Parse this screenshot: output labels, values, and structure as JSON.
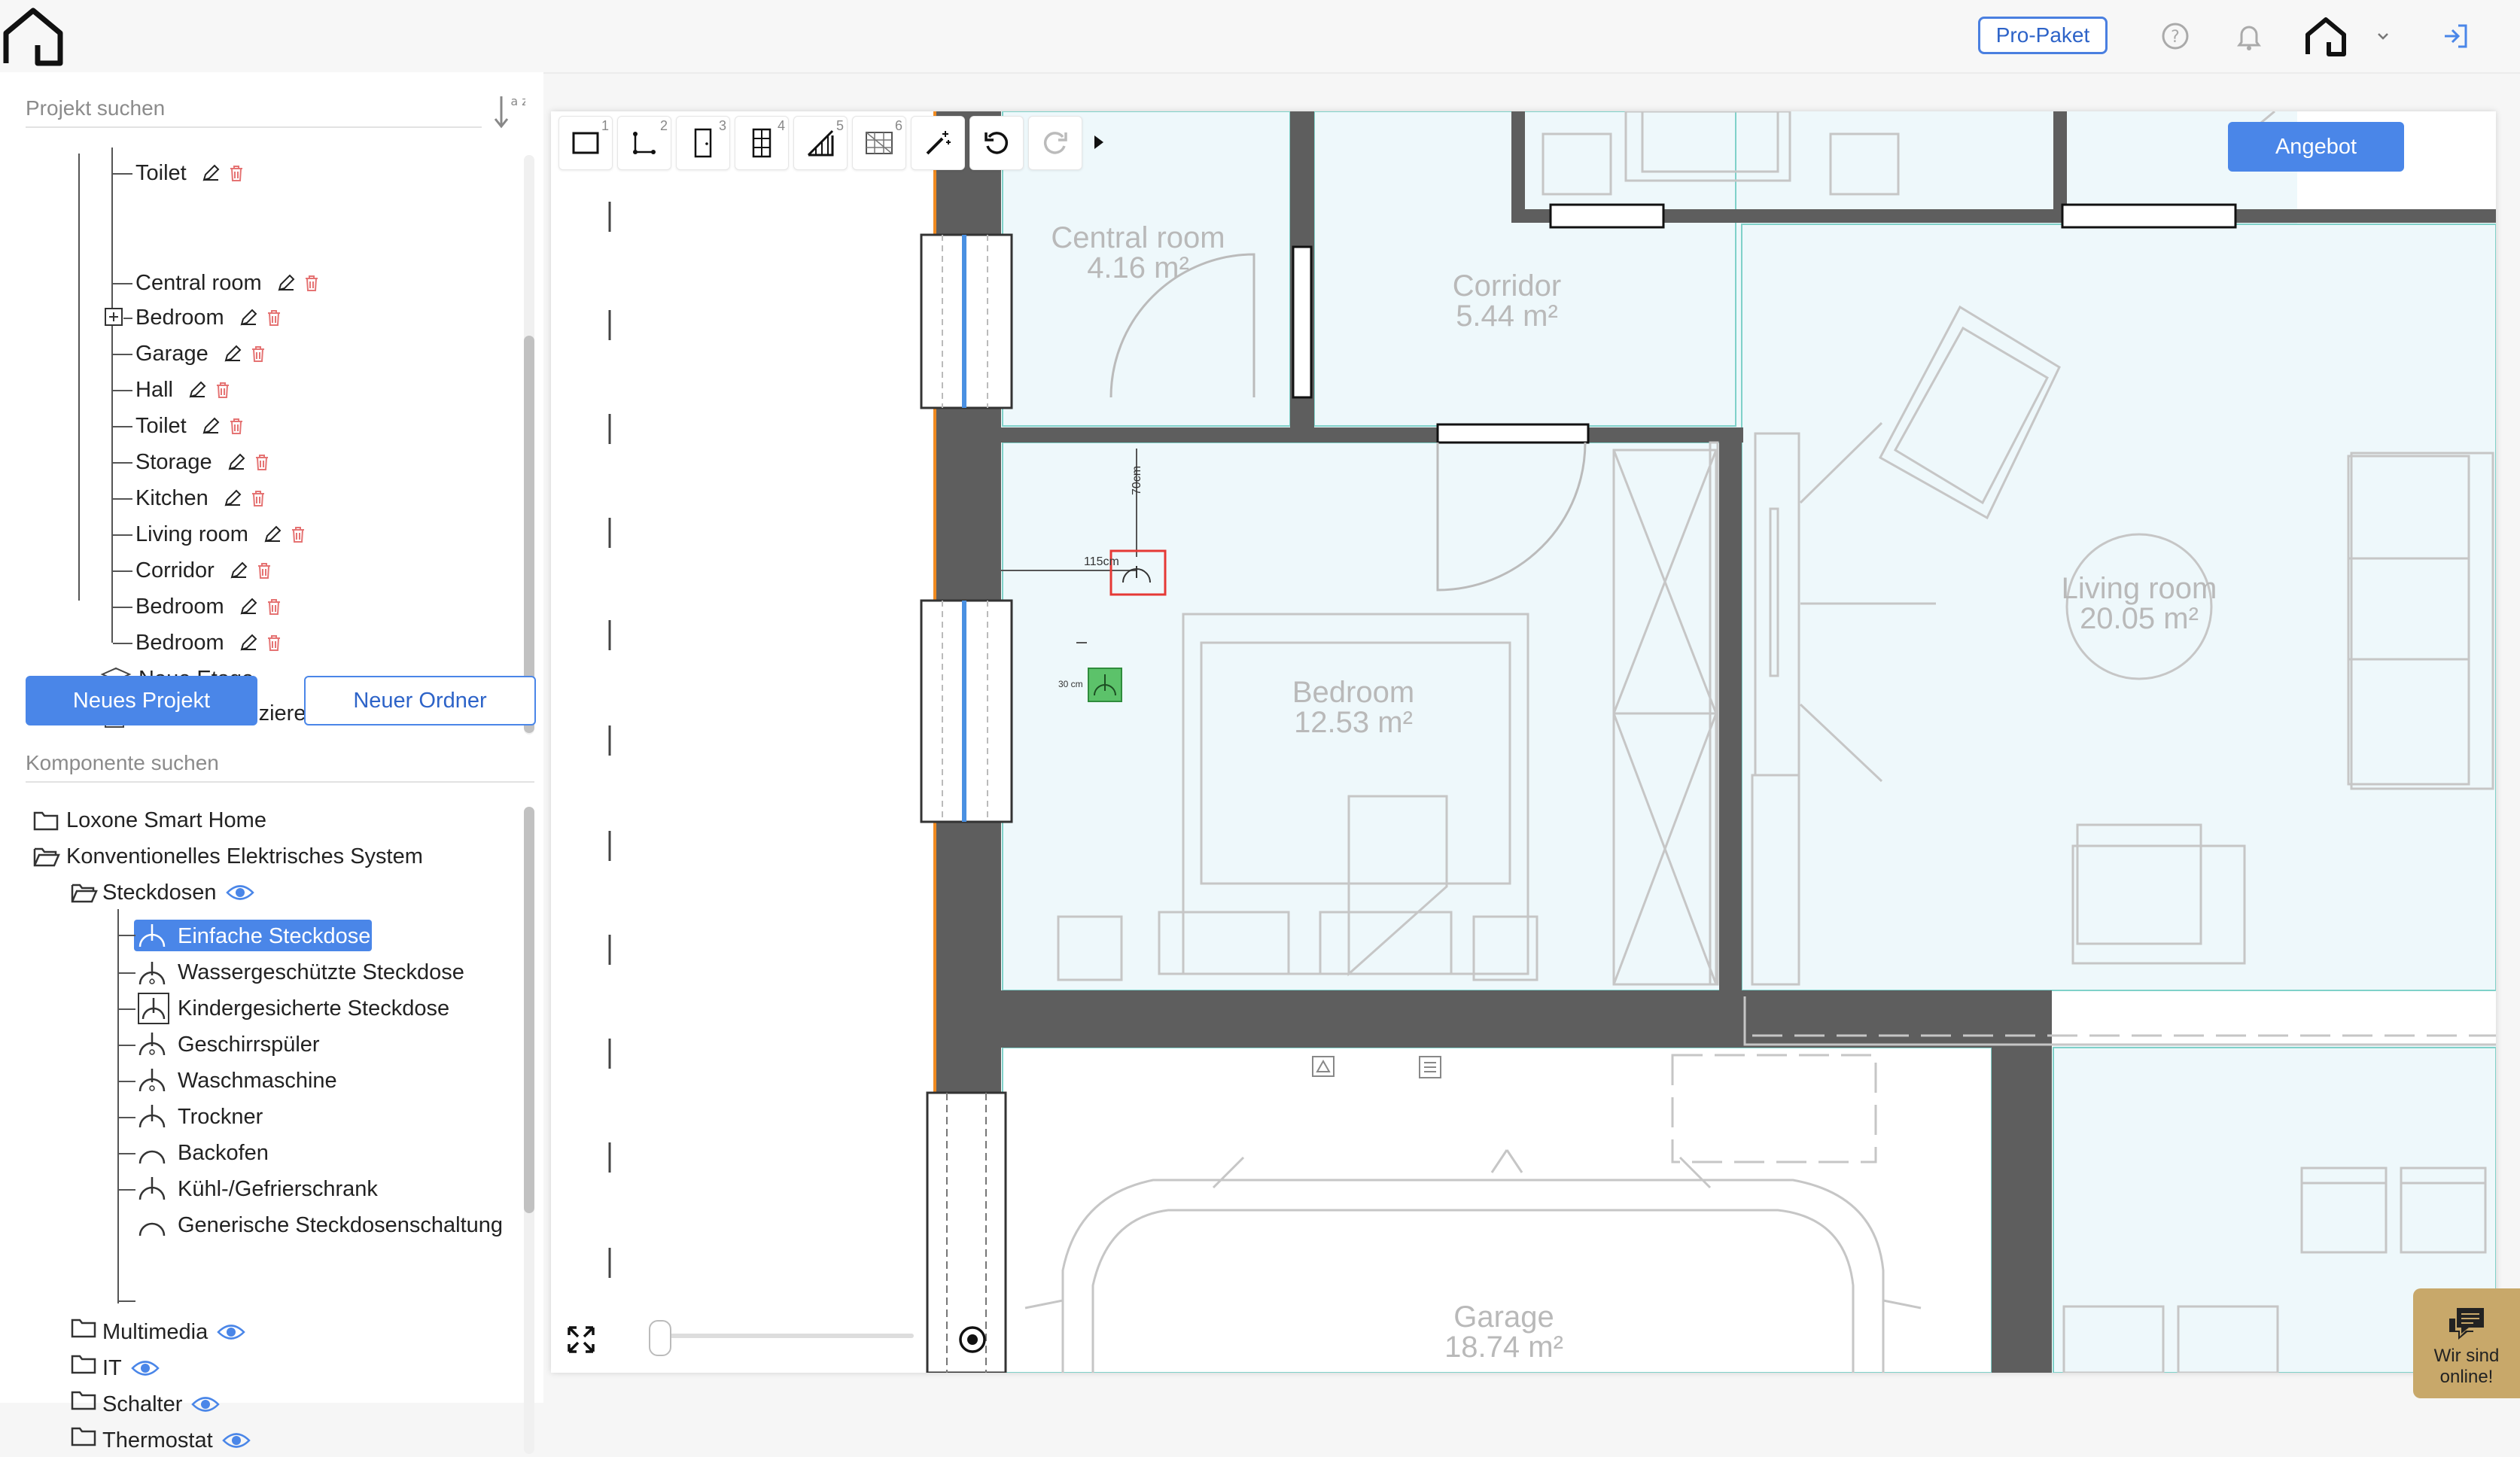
{
  "header": {
    "pro_label": "Pro-Paket"
  },
  "project_panel": {
    "search_placeholder": "Projekt suchen",
    "sort_label": "a z",
    "rooms": [
      {
        "label": "Toilet"
      },
      {
        "label": "Central room"
      },
      {
        "label": "Bedroom"
      },
      {
        "label": "Garage"
      },
      {
        "label": "Hall"
      },
      {
        "label": "Toilet"
      },
      {
        "label": "Storage"
      },
      {
        "label": "Kitchen"
      },
      {
        "label": "Living room"
      },
      {
        "label": "Corridor"
      },
      {
        "label": "Bedroom"
      },
      {
        "label": "Bedroom"
      }
    ],
    "new_floor_label": "Neue Etage",
    "duplicate_label": "Projekt duplizieren",
    "new_project_label": "Neues Projekt",
    "new_folder_label": "Neuer Ordner"
  },
  "component_panel": {
    "search_placeholder": "Komponente suchen",
    "folders": {
      "loxone": "Loxone Smart Home",
      "konventionell": "Konventionelles Elektrisches System",
      "steckdosen": "Steckdosen",
      "multimedia": "Multimedia",
      "it": "IT",
      "schalter": "Schalter",
      "thermostat": "Thermostat"
    },
    "steckdosen_items": [
      {
        "label": "Einfache Steckdose",
        "selected": true
      },
      {
        "label": "Wassergeschützte Steckdose"
      },
      {
        "label": "Kindergesicherte Steckdose"
      },
      {
        "label": "Geschirrspüler"
      },
      {
        "label": "Waschmaschine"
      },
      {
        "label": "Trockner"
      },
      {
        "label": "Backofen"
      },
      {
        "label": "Kühl-/Gefrierschrank"
      },
      {
        "label": "Generische Steckdosenschaltung"
      }
    ]
  },
  "toolbar": {
    "tool_numbers": [
      "1",
      "2",
      "3",
      "4",
      "5",
      "6"
    ]
  },
  "canvas": {
    "angebot_label": "Angebot",
    "rooms": {
      "central": {
        "name": "Central room",
        "area": "4.16 m²"
      },
      "corridor": {
        "name": "Corridor",
        "area": "5.44 m²"
      },
      "bedroom": {
        "name": "Bedroom",
        "area": "12.53 m²"
      },
      "living": {
        "name": "Living room",
        "area": "20.05 m²"
      },
      "garage": {
        "name": "Garage",
        "area": "18.74 m²"
      }
    },
    "dim_horizontal": "115cm",
    "dim_vertical": "70cm",
    "dim_small": "30 cm"
  },
  "chat": {
    "line1": "Wir sind",
    "line2": "online!"
  },
  "colors": {
    "accent": "#4a86e8",
    "room_fill": "#eef8fb",
    "room_border": "#7fd1c9",
    "wall": "#5e5e5e",
    "selection": "#e53935",
    "socket_green": "#5cc26a",
    "delete_red": "#e57373"
  }
}
